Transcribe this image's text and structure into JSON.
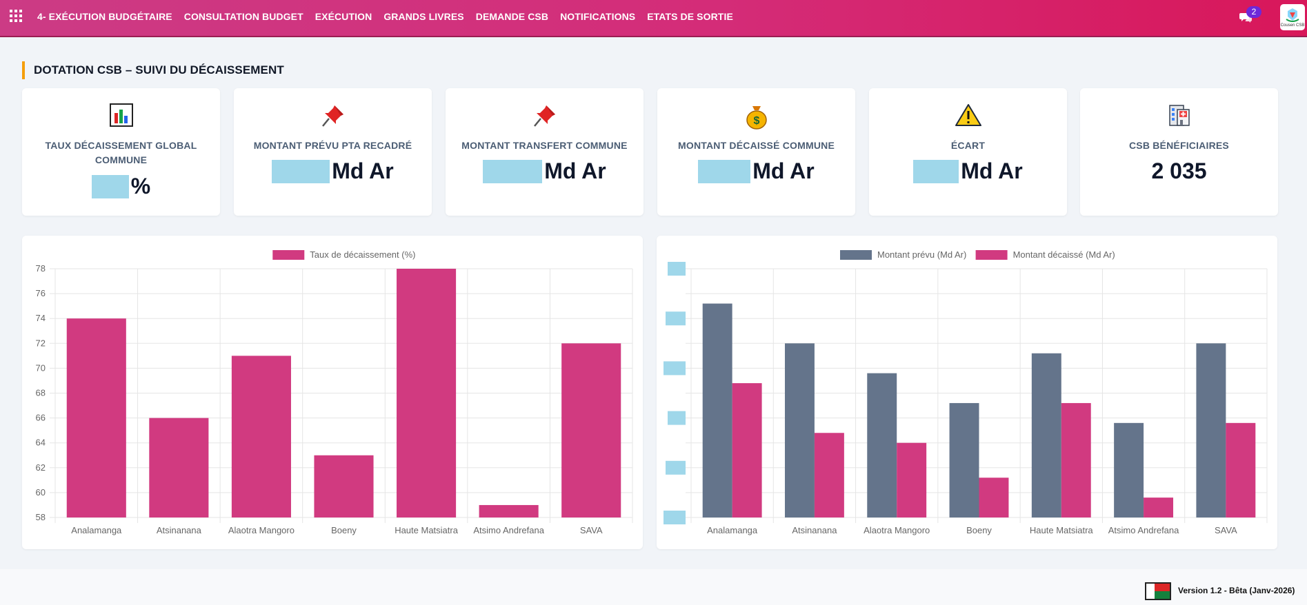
{
  "nav": {
    "items": [
      "4- EXÉCUTION BUDGÉTAIRE",
      "CONSULTATION BUDGET",
      "EXÉCUTION",
      "GRANDS LIVRES",
      "DEMANDE CSB",
      "NOTIFICATIONS",
      "ETATS DE SORTIE"
    ],
    "notification_count": "2",
    "logo_text": "Cousen CSB"
  },
  "page": {
    "section_title": "DOTATION CSB – SUIVI DU DÉCAISSEMENT"
  },
  "kpis": [
    {
      "icon": "bar-chart-icon",
      "label": "TAUX DÉCAISSEMENT GLOBAL COMMUNE",
      "value": "",
      "unit": "%"
    },
    {
      "icon": "pushpin-icon",
      "label": "MONTANT PRÉVU PTA RECADRÉ",
      "value": "",
      "unit": "Md Ar"
    },
    {
      "icon": "pushpin-icon",
      "label": "MONTANT TRANSFERT COMMUNE",
      "value": "",
      "unit": "Md Ar"
    },
    {
      "icon": "money-bag-icon",
      "label": "MONTANT DÉCAISSÉ COMMUNE",
      "value": "",
      "unit": "Md Ar"
    },
    {
      "icon": "warning-icon",
      "label": "ÉCART",
      "value": "",
      "unit": "Md Ar"
    },
    {
      "icon": "hospital-icon",
      "label": "CSB BÉNÉFICIAIRES",
      "value": "2 035",
      "unit": ""
    }
  ],
  "colors": {
    "accent_pink": "#d13a80",
    "slate": "#64748b",
    "redacted": "#9fd7ea",
    "title_bar": "#f59e0b"
  },
  "chart_data": [
    {
      "type": "bar",
      "categories": [
        "Analamanga",
        "Atsinanana",
        "Alaotra Mangoro",
        "Boeny",
        "Haute Matsiatra",
        "Atsimo Andrefana",
        "SAVA"
      ],
      "series": [
        {
          "name": "Taux de décaissement (%)",
          "values": [
            74,
            66,
            71,
            63,
            78,
            59,
            72
          ],
          "color": "#d13a80"
        }
      ],
      "ylim": [
        58,
        78
      ],
      "yticks": [
        78,
        76,
        74,
        72,
        70,
        68,
        66,
        64,
        62,
        60,
        58
      ],
      "grid": true,
      "legend": "top"
    },
    {
      "type": "bar",
      "categories": [
        "Analamanga",
        "Atsinanana",
        "Alaotra Mangoro",
        "Boeny",
        "Haute Matsiatra",
        "Atsimo Andrefana",
        "SAVA"
      ],
      "series": [
        {
          "name": "Montant prévu (Md Ar)",
          "values": [
            0.88,
            0.8,
            0.74,
            0.68,
            0.78,
            0.64,
            0.8
          ],
          "color": "#64748b"
        },
        {
          "name": "Montant décaissé (Md Ar)",
          "values": [
            0.72,
            0.62,
            0.6,
            0.53,
            0.68,
            0.49,
            0.64
          ],
          "color": "#d13a80"
        }
      ],
      "ylim": [
        0.45,
        0.95
      ],
      "yticks_redacted": true,
      "grid": true,
      "legend": "top"
    }
  ],
  "footer": {
    "version": "Version 1.2 - Bêta (Janv-2026)"
  }
}
